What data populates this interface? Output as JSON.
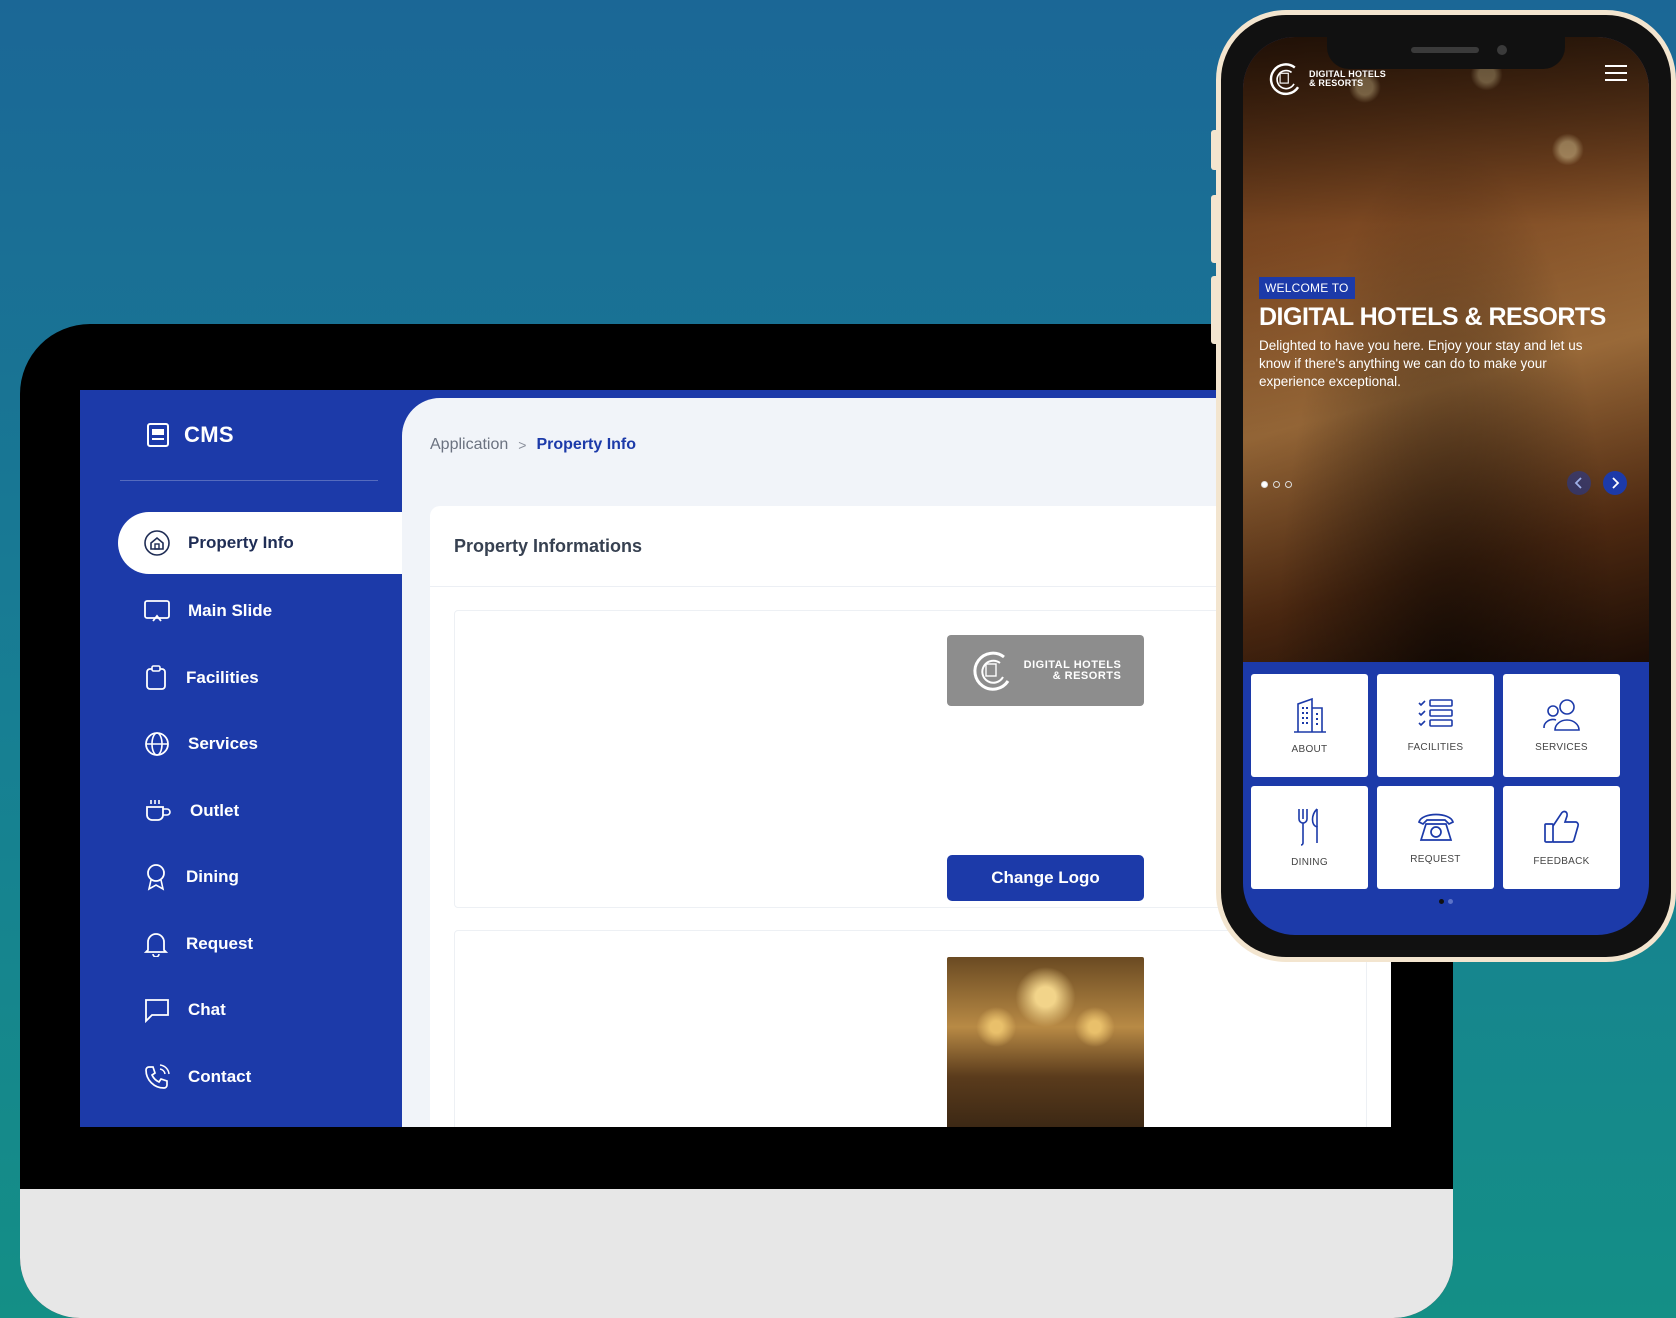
{
  "cms": {
    "brand": "CMS",
    "nav": [
      {
        "label": "Property Info",
        "icon": "home-icon"
      },
      {
        "label": "Main Slide",
        "icon": "slide-icon"
      },
      {
        "label": "Facilities",
        "icon": "clipboard-icon"
      },
      {
        "label": "Services",
        "icon": "globe-icon"
      },
      {
        "label": "Outlet",
        "icon": "coffee-icon"
      },
      {
        "label": "Dining",
        "icon": "award-icon"
      },
      {
        "label": "Request",
        "icon": "bell-icon"
      },
      {
        "label": "Chat",
        "icon": "chat-icon"
      },
      {
        "label": "Contact",
        "icon": "phone-icon"
      }
    ],
    "breadcrumb": {
      "parent": "Application",
      "separator": ">",
      "current": "Property Info"
    },
    "card_title": "Property Informations",
    "logo_text_line1": "DIGITAL HOTELS",
    "logo_text_line2": "& RESORTS",
    "change_logo_label": "Change Logo"
  },
  "phone": {
    "logo_line1": "DIGITAL HOTELS",
    "logo_line2": "& RESORTS",
    "welcome_badge": "WELCOME TO",
    "title": "DIGITAL HOTELS & RESORTS",
    "description": "Delighted to have you here. Enjoy your stay and let us know if there's anything we can do to make your experience exceptional.",
    "tiles": [
      {
        "label": "ABOUT",
        "icon": "building-icon"
      },
      {
        "label": "FACILITIES",
        "icon": "checklist-icon"
      },
      {
        "label": "SERVICES",
        "icon": "users-icon"
      },
      {
        "label": "DINING",
        "icon": "utensils-icon"
      },
      {
        "label": "REQUEST",
        "icon": "telephone-icon"
      },
      {
        "label": "FEEDBACK",
        "icon": "thumbs-up-icon"
      }
    ]
  },
  "colors": {
    "primary": "#1c3aa9",
    "background_top": "#1b6796",
    "background_bottom": "#148f86"
  }
}
